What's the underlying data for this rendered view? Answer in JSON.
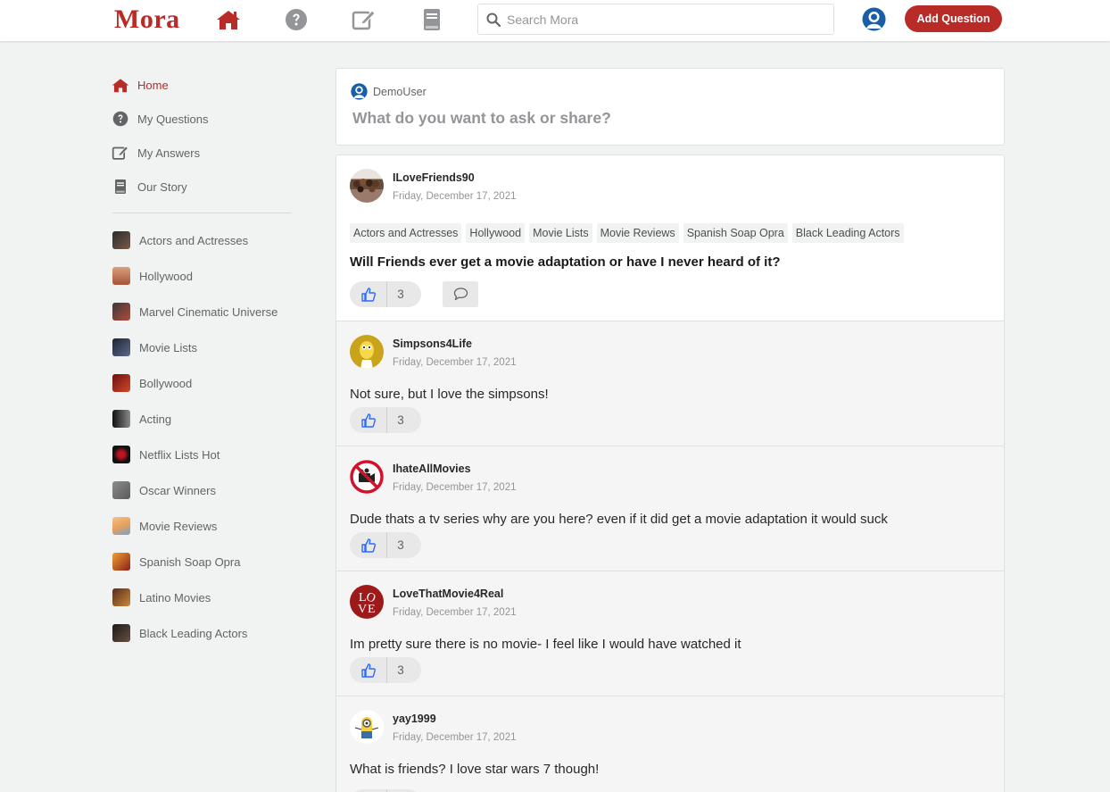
{
  "header": {
    "logo": "Mora",
    "search_placeholder": "Search Mora",
    "add_question_label": "Add Question",
    "nav_icons": [
      "home-icon",
      "question-circle-icon",
      "edit-icon",
      "book-icon"
    ]
  },
  "sidebar": {
    "main_items": [
      {
        "label": "Home",
        "icon": "home-icon",
        "active": true
      },
      {
        "label": "My Questions",
        "icon": "question-circle-icon",
        "active": false
      },
      {
        "label": "My Answers",
        "icon": "edit-icon",
        "active": false
      },
      {
        "label": "Our Story",
        "icon": "book-icon",
        "active": false
      }
    ],
    "spaces": [
      {
        "label": "Actors and Actresses"
      },
      {
        "label": "Hollywood"
      },
      {
        "label": "Marvel Cinematic Universe"
      },
      {
        "label": "Movie Lists"
      },
      {
        "label": "Bollywood"
      },
      {
        "label": "Acting"
      },
      {
        "label": "Netflix Lists Hot"
      },
      {
        "label": "Oscar Winners"
      },
      {
        "label": "Movie Reviews"
      },
      {
        "label": "Spanish Soap Opra"
      },
      {
        "label": "Latino Movies"
      },
      {
        "label": "Black Leading Actors"
      }
    ]
  },
  "ask_box": {
    "username": "DemoUser",
    "prompt": "What do you want to ask or share?"
  },
  "question": {
    "author": "ILoveFriends90",
    "date": "Friday, December 17, 2021",
    "tags": [
      "Actors and Actresses",
      "Hollywood",
      "Movie Lists",
      "Movie Reviews",
      "Spanish Soap Opra",
      "Black Leading Actors"
    ],
    "title": "Will Friends ever get a movie adaptation or have I never heard of it?",
    "votes": "3"
  },
  "answers": [
    {
      "author": "Simpsons4Life",
      "date": "Friday, December 17, 2021",
      "text": "Not sure, but I love the simpsons!",
      "votes": "3"
    },
    {
      "author": "IhateAllMovies",
      "date": "Friday, December 17, 2021",
      "text": "Dude thats a tv series why are you here? even if it did get a movie adaptation it would suck",
      "votes": "3"
    },
    {
      "author": "LoveThatMovie4Real",
      "date": "Friday, December 17, 2021",
      "text": "Im pretty sure there is no movie- I feel like I would have watched it",
      "votes": "3"
    },
    {
      "author": "yay1999",
      "date": "Friday, December 17, 2021",
      "text": "What is friends? I love star wars 7 though!",
      "votes": "3"
    }
  ],
  "colors": {
    "brand": "#b92b27",
    "icon_gray": "#939598",
    "like_blue": "#2e69ff",
    "background": "#f1f2f2"
  }
}
